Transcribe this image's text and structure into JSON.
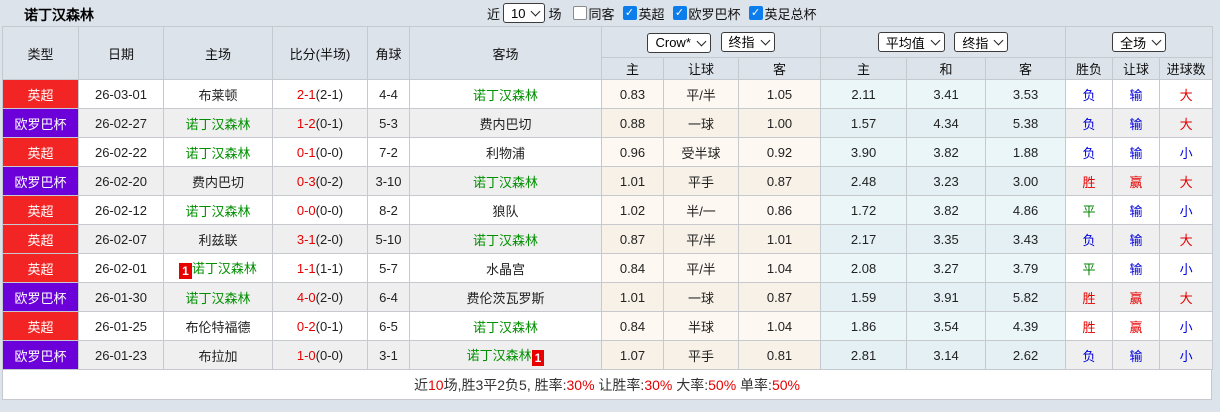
{
  "page": {
    "title": "诺丁汉森林"
  },
  "topbar": {
    "recent_prefix": "近",
    "recent_value": "10",
    "recent_suffix": "场",
    "filters": [
      {
        "label": "同客",
        "checked": false
      },
      {
        "label": "英超",
        "checked": true
      },
      {
        "label": "欧罗巴杯",
        "checked": true
      },
      {
        "label": "英足总杯",
        "checked": true
      }
    ]
  },
  "table": {
    "header": {
      "main_cols": [
        "类型",
        "日期",
        "主场",
        "比分(半场)",
        "角球",
        "客场"
      ],
      "selects": {
        "bookmaker": "Crow*",
        "bookmaker_stage": "终指",
        "average": "平均值",
        "average_stage": "终指",
        "scope": "全场"
      },
      "sub_cols": [
        "主",
        "让球",
        "客",
        "主",
        "和",
        "客",
        "胜负",
        "让球",
        "进球数"
      ]
    },
    "highlight_team": "诺丁汉森林",
    "rows": [
      {
        "league": "英超",
        "league_color": "red",
        "date": "26-03-01",
        "home": {
          "name": "布莱顿",
          "forest": false,
          "badge": "",
          "badge_pos": ""
        },
        "score_ft": "2-1",
        "score_ht": "(2-1)",
        "corners": "4-4",
        "away": {
          "name": "诺丁汉森林",
          "forest": true,
          "badge": "",
          "badge_pos": ""
        },
        "handicap": {
          "home": "0.83",
          "line": "平/半",
          "away": "1.05"
        },
        "avg": {
          "home": "2.11",
          "draw": "3.41",
          "away": "3.53"
        },
        "result": {
          "outcome": "负",
          "handicap": "输",
          "goals": "大"
        }
      },
      {
        "league": "欧罗巴杯",
        "league_color": "purple",
        "date": "26-02-27",
        "home": {
          "name": "诺丁汉森林",
          "forest": true,
          "badge": "",
          "badge_pos": ""
        },
        "score_ft": "1-2",
        "score_ht": "(0-1)",
        "corners": "5-3",
        "away": {
          "name": "费内巴切",
          "forest": false,
          "badge": "",
          "badge_pos": ""
        },
        "handicap": {
          "home": "0.88",
          "line": "一球",
          "away": "1.00"
        },
        "avg": {
          "home": "1.57",
          "draw": "4.34",
          "away": "5.38"
        },
        "result": {
          "outcome": "负",
          "handicap": "输",
          "goals": "大"
        }
      },
      {
        "league": "英超",
        "league_color": "red",
        "date": "26-02-22",
        "home": {
          "name": "诺丁汉森林",
          "forest": true,
          "badge": "",
          "badge_pos": ""
        },
        "score_ft": "0-1",
        "score_ht": "(0-0)",
        "corners": "7-2",
        "away": {
          "name": "利物浦",
          "forest": false,
          "badge": "",
          "badge_pos": ""
        },
        "handicap": {
          "home": "0.96",
          "line": "受半球",
          "away": "0.92"
        },
        "avg": {
          "home": "3.90",
          "draw": "3.82",
          "away": "1.88"
        },
        "result": {
          "outcome": "负",
          "handicap": "输",
          "goals": "小"
        }
      },
      {
        "league": "欧罗巴杯",
        "league_color": "purple",
        "date": "26-02-20",
        "home": {
          "name": "费内巴切",
          "forest": false,
          "badge": "",
          "badge_pos": ""
        },
        "score_ft": "0-3",
        "score_ht": "(0-2)",
        "corners": "3-10",
        "away": {
          "name": "诺丁汉森林",
          "forest": true,
          "badge": "",
          "badge_pos": ""
        },
        "handicap": {
          "home": "1.01",
          "line": "平手",
          "away": "0.87"
        },
        "avg": {
          "home": "2.48",
          "draw": "3.23",
          "away": "3.00"
        },
        "result": {
          "outcome": "胜",
          "handicap": "赢",
          "goals": "大"
        }
      },
      {
        "league": "英超",
        "league_color": "red",
        "date": "26-02-12",
        "home": {
          "name": "诺丁汉森林",
          "forest": true,
          "badge": "",
          "badge_pos": ""
        },
        "score_ft": "0-0",
        "score_ht": "(0-0)",
        "corners": "8-2",
        "away": {
          "name": "狼队",
          "forest": false,
          "badge": "",
          "badge_pos": ""
        },
        "handicap": {
          "home": "1.02",
          "line": "半/一",
          "away": "0.86"
        },
        "avg": {
          "home": "1.72",
          "draw": "3.82",
          "away": "4.86"
        },
        "result": {
          "outcome": "平",
          "handicap": "输",
          "goals": "小"
        }
      },
      {
        "league": "英超",
        "league_color": "red",
        "date": "26-02-07",
        "home": {
          "name": "利兹联",
          "forest": false,
          "badge": "",
          "badge_pos": ""
        },
        "score_ft": "3-1",
        "score_ht": "(2-0)",
        "corners": "5-10",
        "away": {
          "name": "诺丁汉森林",
          "forest": true,
          "badge": "",
          "badge_pos": ""
        },
        "handicap": {
          "home": "0.87",
          "line": "平/半",
          "away": "1.01"
        },
        "avg": {
          "home": "2.17",
          "draw": "3.35",
          "away": "3.43"
        },
        "result": {
          "outcome": "负",
          "handicap": "输",
          "goals": "大"
        }
      },
      {
        "league": "英超",
        "league_color": "red",
        "date": "26-02-01",
        "home": {
          "name": "诺丁汉森林",
          "forest": true,
          "badge": "1",
          "badge_pos": "before"
        },
        "score_ft": "1-1",
        "score_ht": "(1-1)",
        "corners": "5-7",
        "away": {
          "name": "水晶宫",
          "forest": false,
          "badge": "",
          "badge_pos": ""
        },
        "handicap": {
          "home": "0.84",
          "line": "平/半",
          "away": "1.04"
        },
        "avg": {
          "home": "2.08",
          "draw": "3.27",
          "away": "3.79"
        },
        "result": {
          "outcome": "平",
          "handicap": "输",
          "goals": "小"
        }
      },
      {
        "league": "欧罗巴杯",
        "league_color": "purple",
        "date": "26-01-30",
        "home": {
          "name": "诺丁汉森林",
          "forest": true,
          "badge": "",
          "badge_pos": ""
        },
        "score_ft": "4-0",
        "score_ht": "(2-0)",
        "corners": "6-4",
        "away": {
          "name": "费伦茨瓦罗斯",
          "forest": false,
          "badge": "",
          "badge_pos": ""
        },
        "handicap": {
          "home": "1.01",
          "line": "一球",
          "away": "0.87"
        },
        "avg": {
          "home": "1.59",
          "draw": "3.91",
          "away": "5.82"
        },
        "result": {
          "outcome": "胜",
          "handicap": "赢",
          "goals": "大"
        }
      },
      {
        "league": "英超",
        "league_color": "red",
        "date": "26-01-25",
        "home": {
          "name": "布伦特福德",
          "forest": false,
          "badge": "",
          "badge_pos": ""
        },
        "score_ft": "0-2",
        "score_ht": "(0-1)",
        "corners": "6-5",
        "away": {
          "name": "诺丁汉森林",
          "forest": true,
          "badge": "",
          "badge_pos": ""
        },
        "handicap": {
          "home": "0.84",
          "line": "半球",
          "away": "1.04"
        },
        "avg": {
          "home": "1.86",
          "draw": "3.54",
          "away": "4.39"
        },
        "result": {
          "outcome": "胜",
          "handicap": "赢",
          "goals": "小"
        }
      },
      {
        "league": "欧罗巴杯",
        "league_color": "purple",
        "date": "26-01-23",
        "home": {
          "name": "布拉加",
          "forest": false,
          "badge": "",
          "badge_pos": ""
        },
        "score_ft": "1-0",
        "score_ht": "(0-0)",
        "corners": "3-1",
        "away": {
          "name": "诺丁汉森林",
          "forest": true,
          "badge": "1",
          "badge_pos": "after"
        },
        "handicap": {
          "home": "1.07",
          "line": "平手",
          "away": "0.81"
        },
        "avg": {
          "home": "2.81",
          "draw": "3.14",
          "away": "2.62"
        },
        "result": {
          "outcome": "负",
          "handicap": "输",
          "goals": "小"
        }
      }
    ]
  },
  "footer": {
    "segments": [
      {
        "text": "近",
        "red": false
      },
      {
        "text": "10",
        "red": true
      },
      {
        "text": "场,胜3平2负5, 胜率:",
        "red": false
      },
      {
        "text": "30%",
        "red": true
      },
      {
        "text": " 让胜率:",
        "red": false
      },
      {
        "text": "30%",
        "red": true
      },
      {
        "text": " 大率:",
        "red": false
      },
      {
        "text": "50%",
        "red": true
      },
      {
        "text": " 单率:",
        "red": false
      },
      {
        "text": "50%",
        "red": true
      }
    ]
  },
  "result_color_map": {
    "胜": "r-red",
    "平": "r-green",
    "负": "r-blue",
    "赢": "r-red",
    "输": "r-blue",
    "大": "r-red",
    "小": "r-blue"
  },
  "icons": {
    "checkbox_check": "✓",
    "select_chevron": "chevron-down"
  },
  "colors": {
    "page_bg": "#dce3eb",
    "epl_red": "#f22424",
    "europa_purple": "#6b00d8",
    "team_green": "#008f00",
    "score_red": "#e60000",
    "result_blue": "#0000dd",
    "result_green": "#008000",
    "checkbox_blue": "#0d7deb"
  }
}
